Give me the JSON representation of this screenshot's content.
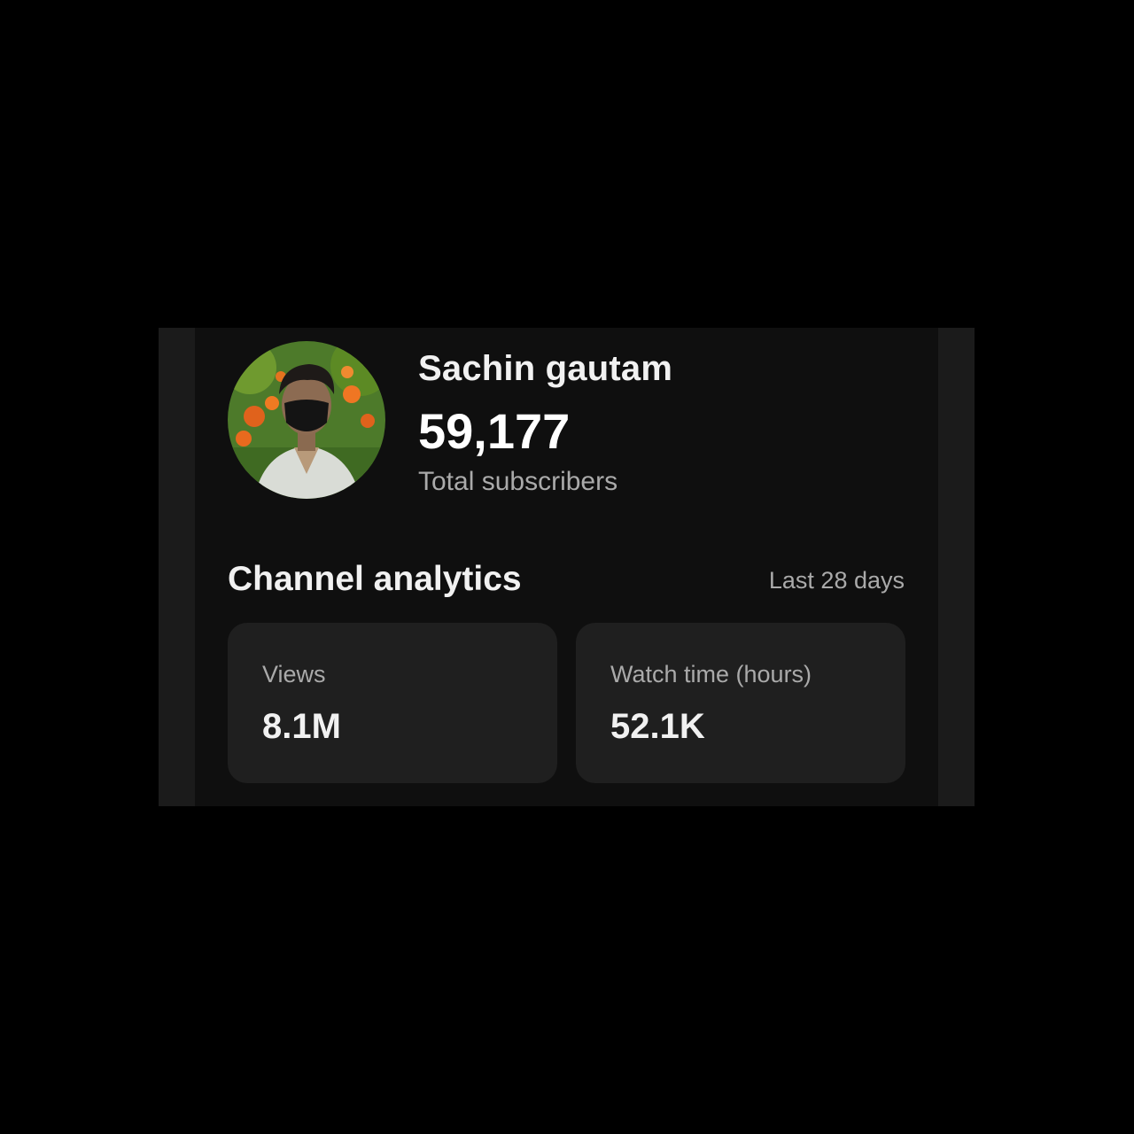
{
  "channel": {
    "name": "Sachin gautam",
    "subscriber_count": "59,177",
    "subscriber_label": "Total subscribers",
    "avatar_icon": "channel-avatar-photo"
  },
  "analytics": {
    "title": "Channel analytics",
    "period": "Last 28 days",
    "cards": [
      {
        "label": "Views",
        "value": "8.1M"
      },
      {
        "label": "Watch time (hours)",
        "value": "52.1K"
      }
    ]
  },
  "colors": {
    "background": "#000000",
    "panel": "#0f0f0f",
    "card": "#1f1f1f",
    "primary_text": "#f1f1f1",
    "secondary_text": "#aaaaaa"
  }
}
